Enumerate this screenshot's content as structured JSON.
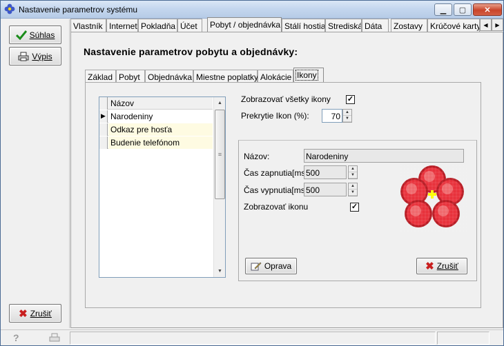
{
  "window": {
    "title": "Nastavenie parametrov systému",
    "icon": "flower-app-icon"
  },
  "sidebar": {
    "suhlas_label": "Súhlas",
    "vypis_label": "Výpis",
    "zrusit_label": "Zrušiť"
  },
  "tabs": [
    "Vlastník",
    "Internet",
    "Pokladňa",
    "Účet",
    "Pobyt / objednávka",
    "Stálí hostia",
    "Strediská",
    "Dáta",
    "Zostavy",
    "Krúčové karty"
  ],
  "active_tab": "Pobyt / objednávka",
  "page": {
    "heading": "Nastavenie parametrov pobytu a objednávky:",
    "subtabs": [
      "Základ",
      "Pobyt",
      "Objednávka",
      "Miestne poplatky",
      "Alokácie",
      "Ikony"
    ],
    "active_subtab": "Ikony"
  },
  "grid": {
    "header": "Názov",
    "rows": [
      "Narodeniny",
      "Odkaz pre hosťa",
      "Budenie telefónom"
    ],
    "selected_index": 0
  },
  "settings": {
    "show_all_label": "Zobrazovať všetky ikony",
    "show_all_checked": true,
    "overlap_label": "Prekrytie Ikon (%):",
    "overlap_value": "70"
  },
  "detail": {
    "name_label": "Názov:",
    "name_value": "Narodeniny",
    "on_time_label": "Čas zapnutia[ms]:",
    "on_time_value": "500",
    "off_time_label": "Čas vypnutia[ms]:",
    "off_time_value": "500",
    "show_icon_label": "Zobrazovať ikonu",
    "show_icon_checked": true,
    "edit_label": "Oprava",
    "cancel_label": "Zrušiť",
    "icon_colors": {
      "petal": "#e8323c",
      "petal_dark": "#b81c24",
      "petal_light": "#f06a6e",
      "center": "#ffff00"
    }
  }
}
